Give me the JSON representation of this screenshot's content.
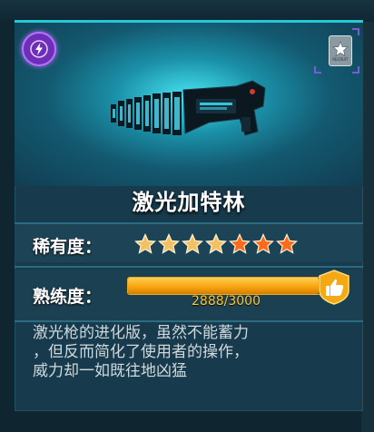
{
  "item": {
    "name": "激光加特林",
    "type_icon": "lightning-icon",
    "rank_icon": "star-rank-emblem",
    "rank_caption": "RECRUIT"
  },
  "rarity": {
    "label": "稀有度：",
    "stars_total": 7,
    "stars_filled": 7,
    "star_colors": [
      "#f5c062",
      "#f5c062",
      "#f5c062",
      "#f5c062",
      "#ff6a1a",
      "#ff6a1a",
      "#ff6a1a"
    ]
  },
  "mastery": {
    "label": "熟练度：",
    "current": 2888,
    "max": 3000,
    "text": "2888/3000",
    "badge_icon": "thumbs-up-icon"
  },
  "description": {
    "line1": "激光枪的进化版，虽然不能蓄力",
    "line2": "，但反而简化了使用者的操作，",
    "line3": "威力却一如既往地凶猛"
  },
  "colors": {
    "accent": "#25c9d6",
    "card_bg": "#173b4d",
    "bar": "#f7a10a",
    "badge_purple": "#6d2fb8"
  }
}
